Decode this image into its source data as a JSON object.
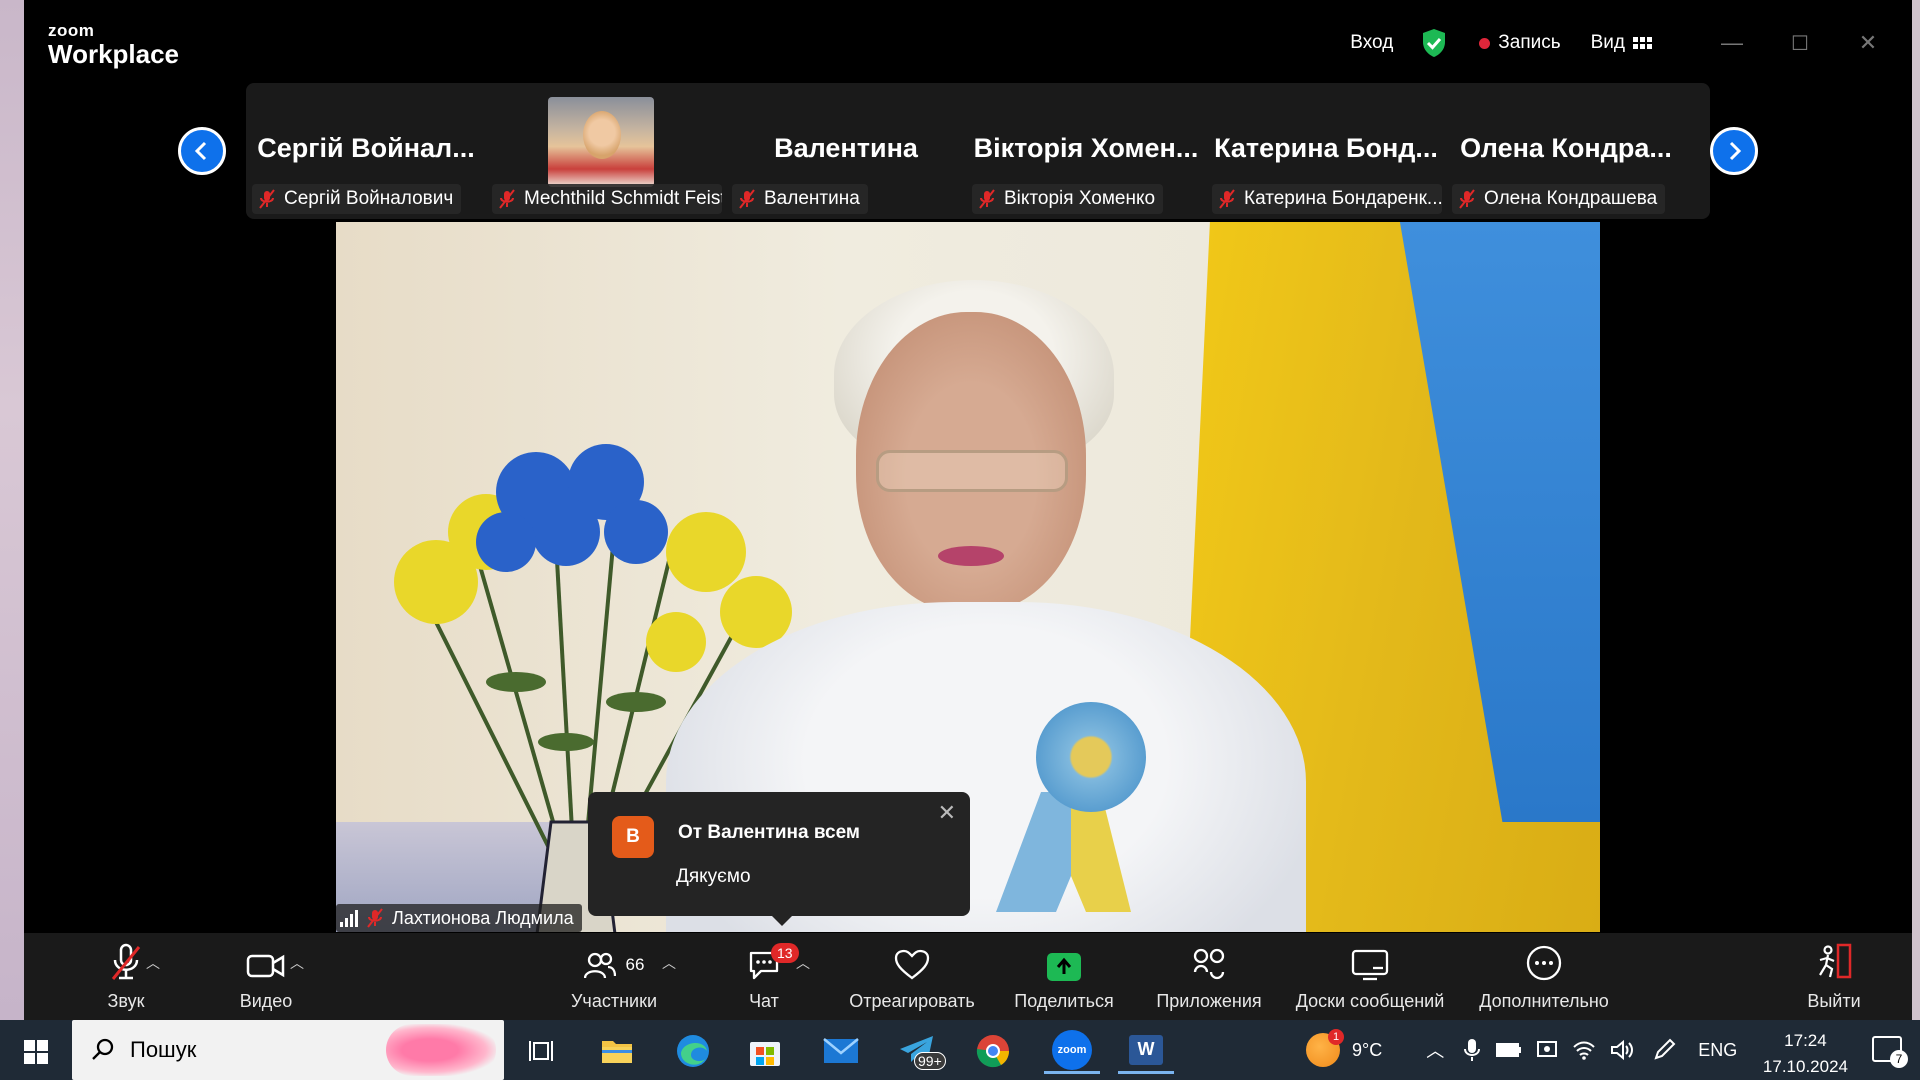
{
  "titlebar": {
    "brand_top": "zoom",
    "brand_bottom": "Workplace",
    "signin_label": "Вход",
    "record_label": "Запись",
    "view_label": "Вид",
    "minimize_glyph": "—",
    "maximize_glyph": "☐",
    "close_glyph": "✕"
  },
  "strip": {
    "tiles": [
      {
        "big": "Сергій Войнал...",
        "tag": "Сергій Войналович",
        "has_photo": false
      },
      {
        "big": "",
        "tag": "Mechthild Schmidt Feist",
        "has_photo": true
      },
      {
        "big": "Валентина",
        "tag": "Валентина",
        "has_photo": false
      },
      {
        "big": "Вікторія Хомен...",
        "tag": "Вікторія Хоменко",
        "has_photo": false
      },
      {
        "big": "Катерина Бонд...",
        "tag": "Катерина Бондаренк...",
        "has_photo": false
      },
      {
        "big": "Олена Кондра...",
        "tag": "Олена Кондрашева",
        "has_photo": false
      }
    ]
  },
  "video": {
    "speaker_name": "Лахтионова Людмила"
  },
  "chat_popup": {
    "avatar_letter": "В",
    "from": "От Валентина всем",
    "message": "Дякуємо",
    "close_glyph": "✕"
  },
  "toolbar": {
    "audio_label": "Звук",
    "video_label": "Видео",
    "participants_label": "Участники",
    "participants_count": "66",
    "chat_label": "Чат",
    "chat_badge": "13",
    "react_label": "Отреагировать",
    "share_label": "Поделиться",
    "apps_label": "Приложения",
    "whiteboards_label": "Доски сообщений",
    "more_label": "Дополнительно",
    "leave_label": "Выйти"
  },
  "taskbar": {
    "search_label": "Пошук",
    "telegram_badge": "99+",
    "zoom_app_label": "zoom",
    "word_app_label": "W",
    "weather_badge": "1",
    "temperature": "9°C",
    "language": "ENG",
    "time": "17:24",
    "date": "17.10.2024",
    "notification_count": "7"
  },
  "colors": {
    "accent_blue": "#0e71eb",
    "record_red": "#e0263a",
    "share_green": "#1db954",
    "chat_avatar": "#e45b1a",
    "shield_green": "#1db954"
  }
}
